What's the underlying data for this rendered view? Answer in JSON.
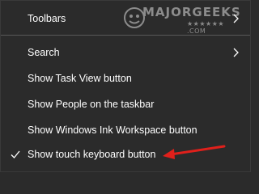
{
  "menu": {
    "items": [
      {
        "label": "Toolbars",
        "has_submenu": true,
        "checked": false
      },
      {
        "label": "Search",
        "has_submenu": true,
        "checked": false
      },
      {
        "label": "Show Task View button",
        "has_submenu": false,
        "checked": false
      },
      {
        "label": "Show People on the taskbar",
        "has_submenu": false,
        "checked": false
      },
      {
        "label": "Show Windows Ink Workspace button",
        "has_submenu": false,
        "checked": false
      },
      {
        "label": "Show touch keyboard button",
        "has_submenu": false,
        "checked": true
      }
    ]
  },
  "watermark": {
    "main": "MAJORGEEKS",
    "sub": "★★★★★★ .COM"
  },
  "icons": {
    "submenu": "chevron-right-icon",
    "check": "checkmark-icon",
    "annotation": "red-arrow-icon"
  },
  "colors": {
    "background": "#2b2b2b",
    "text": "#ffffff",
    "annotation": "#e0201b"
  }
}
